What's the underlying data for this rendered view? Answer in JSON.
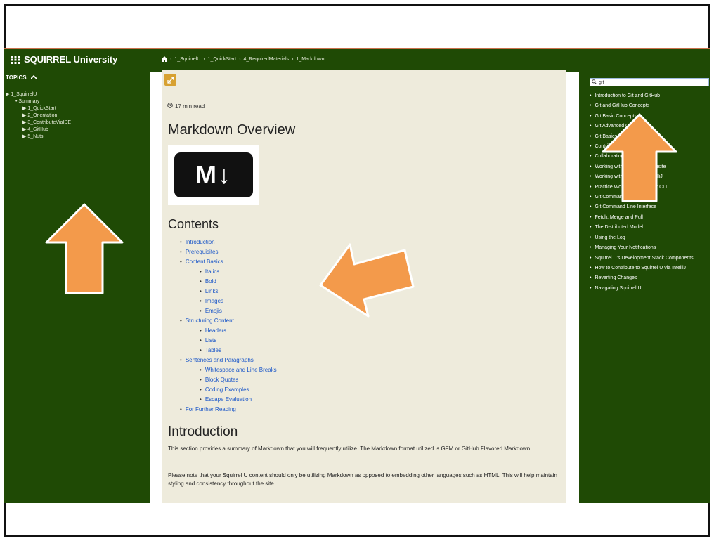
{
  "header": {
    "brand": "SQUIRREL University",
    "breadcrumb": [
      "1_SquirrelU",
      "1_QuickStart",
      "4_RequiredMaterials",
      "1_Markdown"
    ]
  },
  "sidebar": {
    "topics_label": "TOPICS",
    "tree": [
      {
        "label": "1_SquirrelU",
        "level": 1
      },
      {
        "label": "Summary",
        "level": 2
      },
      {
        "label": "1_QuickStart",
        "level": 3
      },
      {
        "label": "2_Orientation",
        "level": 3
      },
      {
        "label": "3_ContributeViaIDE",
        "level": 3
      },
      {
        "label": "4_GitHub",
        "level": 3
      },
      {
        "label": "5_Nuts",
        "level": 3
      }
    ]
  },
  "content": {
    "read_time": "17 min read",
    "title": "Markdown Overview",
    "logo_text": "M↓",
    "contents_heading": "Contents",
    "toc": [
      {
        "label": "Introduction",
        "sub": false
      },
      {
        "label": "Prerequisites",
        "sub": false
      },
      {
        "label": "Content Basics",
        "sub": false
      },
      {
        "label": "Italics",
        "sub": true
      },
      {
        "label": "Bold",
        "sub": true
      },
      {
        "label": "Links",
        "sub": true
      },
      {
        "label": "Images",
        "sub": true
      },
      {
        "label": "Emojis",
        "sub": true
      },
      {
        "label": "Structuring Content",
        "sub": false
      },
      {
        "label": "Headers",
        "sub": true
      },
      {
        "label": "Lists",
        "sub": true
      },
      {
        "label": "Tables",
        "sub": true
      },
      {
        "label": "Sentences and Paragraphs",
        "sub": false
      },
      {
        "label": "Whitespace and Line Breaks",
        "sub": true
      },
      {
        "label": "Block Quotes",
        "sub": true
      },
      {
        "label": "Coding Examples",
        "sub": true
      },
      {
        "label": "Escape Evaluation",
        "sub": true
      },
      {
        "label": "For Further Reading",
        "sub": false
      }
    ],
    "intro_heading": "Introduction",
    "para1": "This section provides a summary of Markdown that you will frequently utilize. The Markdown format utilized is GFM or GitHub Flavored Markdown.",
    "para2": "Please note that your Squirrel U content should only be utilizing Markdown as opposed to embedding other languages such as HTML. This will help maintain styling and consistency throughout the site."
  },
  "search": {
    "value": "git",
    "results": [
      "Introduction to Git and GitHub",
      "Git and GitHub Concepts",
      "Git Basic Concepts",
      "Git Advanced Concepts",
      "Git Basics",
      "Contributing with GitHub",
      "Collaborating with GitHub",
      "Working with the GitHub website",
      "Working with GitHub via IntelliJ",
      "Practice Working with the Git CLI",
      "Git Command Line Interface",
      "Git Command Line Interface",
      "Fetch, Merge and Pull",
      "The Distributed Model",
      "Using the Log",
      "Managing Your Notifications",
      "Squirrel U's Development Stack Components",
      "How to Contribute to Squirrel U via IntelliJ",
      "Reverting Changes",
      "Navigating Squirrel U"
    ]
  },
  "colors": {
    "panel_green": "#1f4a05",
    "content_bg": "#eeebdc",
    "link_blue": "#1a56c8",
    "arrow_orange": "#f39a4b"
  }
}
